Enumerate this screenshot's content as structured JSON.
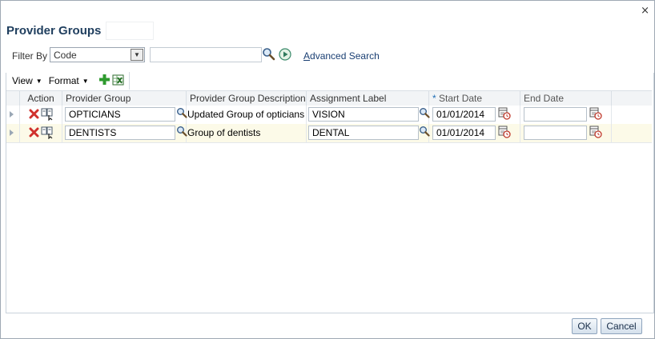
{
  "dialog": {
    "close_label": "×",
    "title": "Provider Groups"
  },
  "filter": {
    "label": "Filter By",
    "selected": "Code",
    "input_value": "",
    "advanced_search_first": "A",
    "advanced_search_rest": "dvanced Search"
  },
  "toolbar": {
    "view_label": "View",
    "format_label": "Format"
  },
  "table": {
    "headers": {
      "action": "Action",
      "provider_group": "Provider Group",
      "description": "Provider Group Description",
      "assignment_label": "Assignment Label",
      "required_mark": "*",
      "start_date": "Start Date",
      "end_date": "End Date"
    },
    "rows": [
      {
        "provider_group": "OPTICIANS",
        "description": "Updated Group of opticians",
        "assignment_label": "VISION",
        "start_date": "01/01/2014",
        "end_date": ""
      },
      {
        "provider_group": "DENTISTS",
        "description": "Group of dentists",
        "assignment_label": "DENTAL",
        "start_date": "01/01/2014",
        "end_date": ""
      }
    ]
  },
  "buttons": {
    "ok": "OK",
    "cancel": "Cancel"
  },
  "colors": {
    "title": "#1f3e5e",
    "selected_row": "#fcfae8",
    "link": "#1a3f73",
    "delete_icon": "#d0312d"
  },
  "icons": [
    "close-icon",
    "dropdown-arrow-icon",
    "search-icon",
    "go-icon",
    "add-icon",
    "export-excel-icon",
    "expand-icon",
    "delete-icon",
    "duplicate-icon",
    "lov-search-icon",
    "calendar-icon"
  ]
}
